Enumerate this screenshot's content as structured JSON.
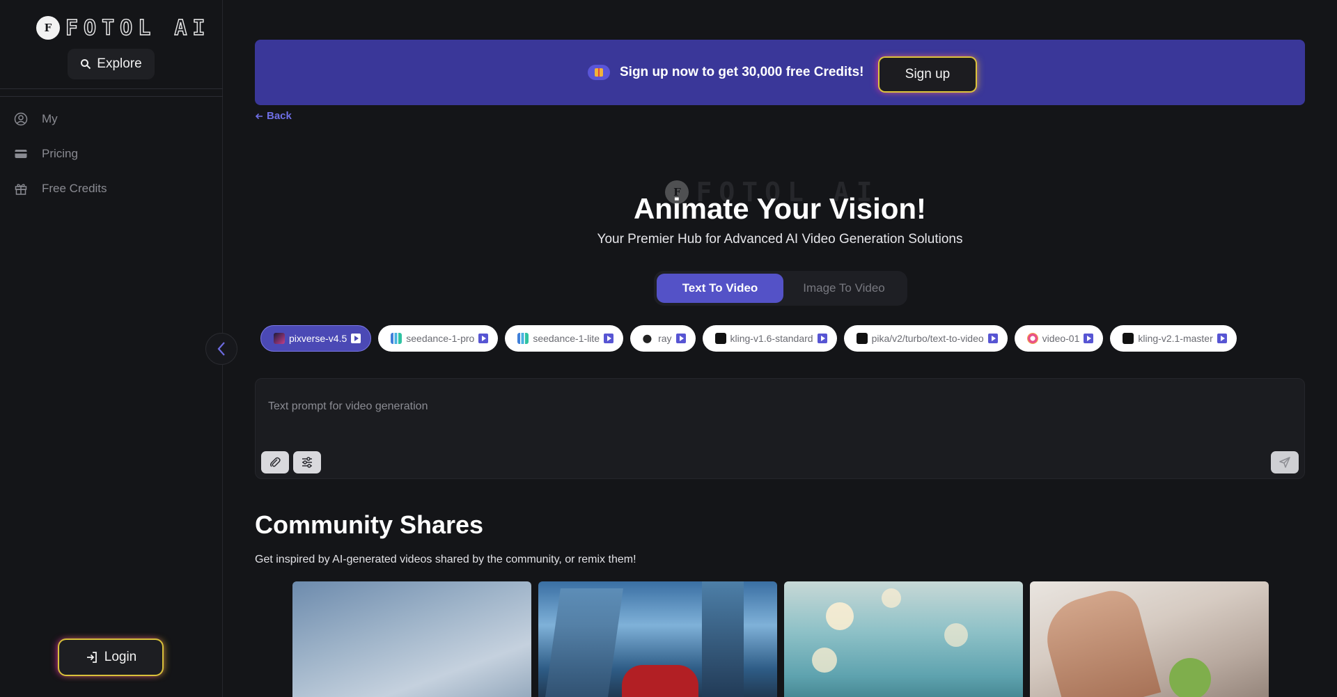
{
  "sidebar": {
    "logo_text": "FOTOL AI",
    "logo_mark": "F",
    "explore_label": "Explore",
    "items": [
      {
        "label": "My",
        "icon": "user-circle-icon"
      },
      {
        "label": "Pricing",
        "icon": "credit-card-icon"
      },
      {
        "label": "Free Credits",
        "icon": "gift-icon"
      }
    ],
    "login_label": "Login"
  },
  "banner": {
    "text": "Sign up now to get 30,000 free Credits!",
    "signup_label": "Sign up"
  },
  "back_label": "Back",
  "hero": {
    "watermark": "FOTOL AI",
    "title": "Animate Your Vision!",
    "subtitle": "Your Premier Hub for Advanced AI Video Generation Solutions"
  },
  "mode_tabs": {
    "active": "Text To Video",
    "inactive": "Image To Video"
  },
  "models": [
    {
      "label": "pixverse-v4.5",
      "active": true
    },
    {
      "label": "seedance-1-pro",
      "active": false
    },
    {
      "label": "seedance-1-lite",
      "active": false
    },
    {
      "label": "ray",
      "active": false
    },
    {
      "label": "kling-v1.6-standard",
      "active": false
    },
    {
      "label": "pika/v2/turbo/text-to-video",
      "active": false
    },
    {
      "label": "video-01",
      "active": false
    },
    {
      "label": "kling-v2.1-master",
      "active": false
    }
  ],
  "prompt": {
    "placeholder": "Text prompt for video generation"
  },
  "community": {
    "title": "Community Shares",
    "subtitle": "Get inspired by AI-generated videos shared by the community, or remix them!"
  },
  "colors": {
    "accent": "#5452c7",
    "banner": "#3a3799",
    "background": "#141518"
  }
}
